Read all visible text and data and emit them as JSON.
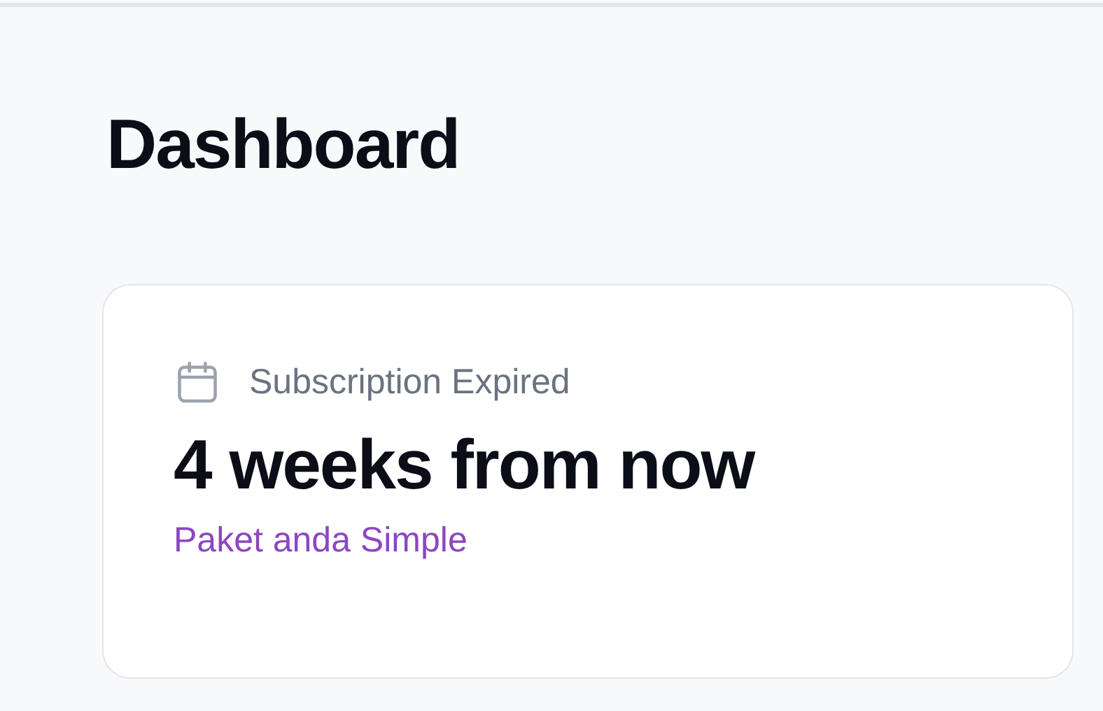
{
  "page": {
    "title": "Dashboard"
  },
  "card": {
    "label": "Subscription Expired",
    "value": "4 weeks from now",
    "note": "Paket anda Simple"
  }
}
